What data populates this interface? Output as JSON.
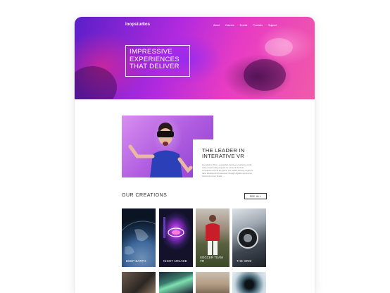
{
  "brand": {
    "logo": "loopstudios"
  },
  "nav": {
    "links": [
      "About",
      "Careers",
      "Events",
      "Products",
      "Support"
    ]
  },
  "hero": {
    "title": "IMPRESSIVE EXPERIENCES THAT DELIVER"
  },
  "intro": {
    "title": "THE LEADER IN INTERATIVE VR",
    "body": "Founded in 2011, Loopstudios has been producing world-class virtual reality projects for some of the best companies around the globe. Our award-winning creations have transformed businesses through digital experiences that bind to their brand."
  },
  "creations": {
    "title": "OUR CREATIONS",
    "see_all": "SEE ALL",
    "cards": [
      {
        "label": "DEEP EARTH"
      },
      {
        "label": "NIGHT ARCADE"
      },
      {
        "label": "SOCCER TEAM VR"
      },
      {
        "label": "THE GRID"
      }
    ]
  },
  "colors": {
    "hero_purple": "#5a1fc7",
    "hero_pink": "#e83bc4",
    "text_dark": "#222222"
  }
}
